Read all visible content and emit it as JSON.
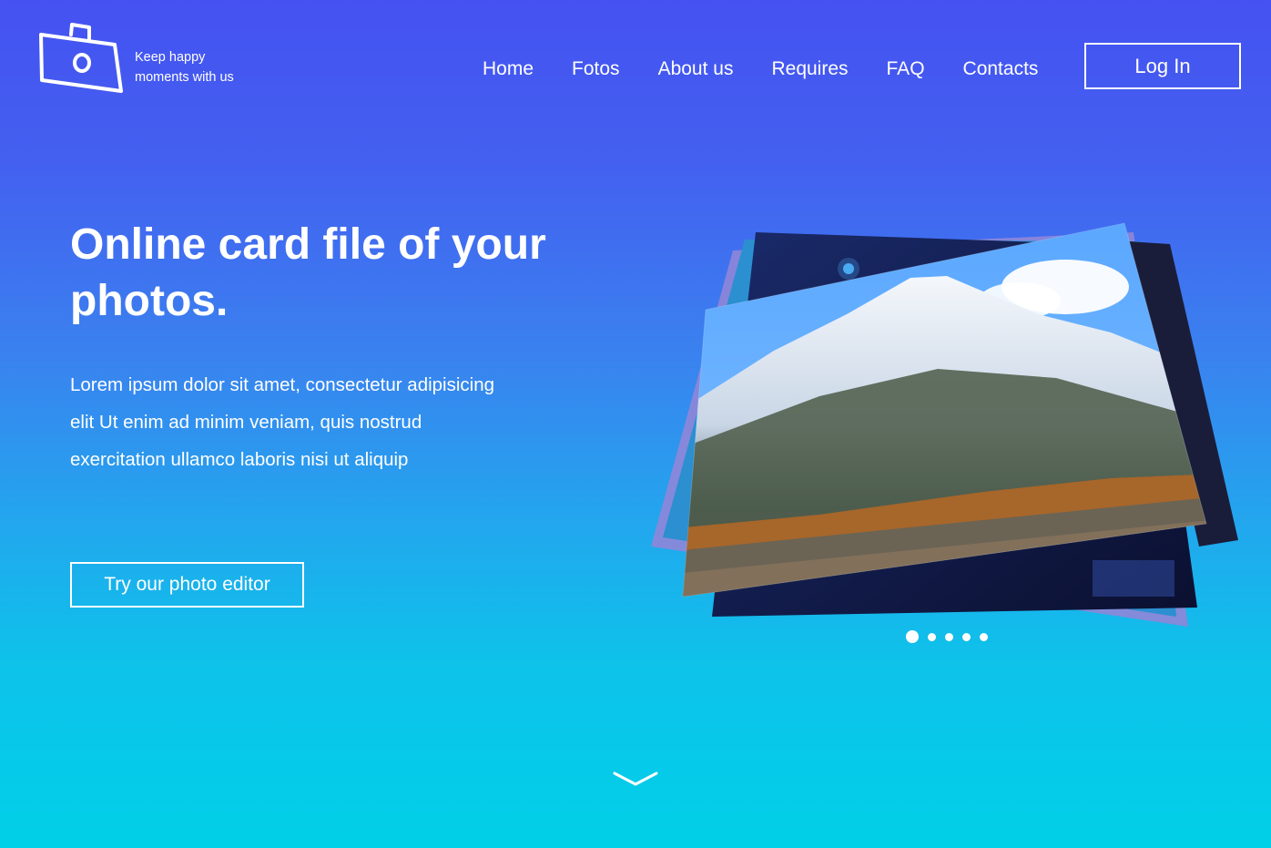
{
  "header": {
    "logo_tagline": "Keep happy moments with us",
    "logo_icon": "camera-bag-icon",
    "nav": [
      {
        "label": "Home"
      },
      {
        "label": "Fotos"
      },
      {
        "label": "About us"
      },
      {
        "label": "Requires"
      },
      {
        "label": "FAQ"
      },
      {
        "label": "Contacts"
      }
    ],
    "login_label": "Log In"
  },
  "hero": {
    "title": "Online card file of your photos.",
    "description": "Lorem ipsum dolor sit amet, consectetur adipisicing elit Ut enim ad minim veniam, quis nostrud exercitation ullamco laboris nisi ut aliquip",
    "cta_label": "Try our photo editor"
  },
  "carousel": {
    "slide_count": 5,
    "active_index": 0
  },
  "scroll_icon": "chevron-down-icon",
  "colors": {
    "gradient_top": "#4552f1",
    "gradient_bottom": "#00d0e8",
    "text": "#ffffff"
  }
}
